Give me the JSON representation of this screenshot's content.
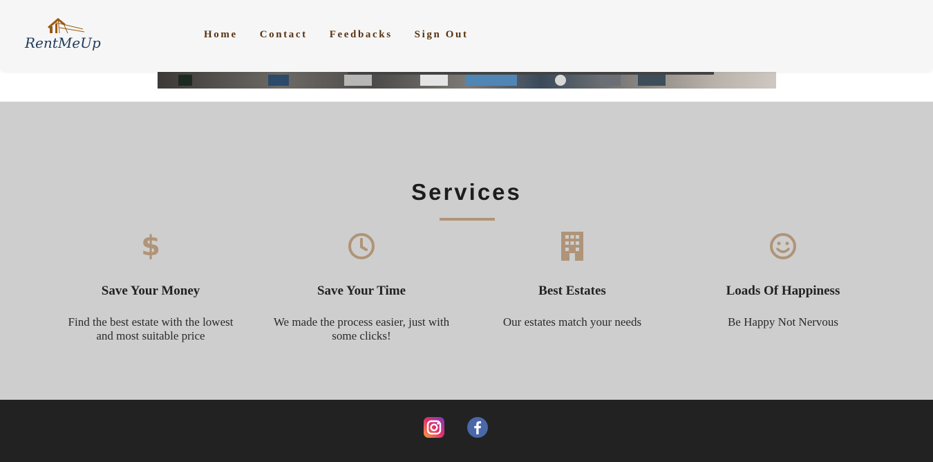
{
  "brand": {
    "logo_text": "RentMeUp"
  },
  "nav": {
    "items": [
      {
        "label": "Home"
      },
      {
        "label": "Contact"
      },
      {
        "label": "Feedbacks"
      },
      {
        "label": "Sign Out"
      }
    ]
  },
  "services": {
    "title": "Services",
    "items": [
      {
        "icon": "dollar-icon",
        "title": "Save Your Money",
        "text": "Find the best estate with the lowest and most suitable price"
      },
      {
        "icon": "clock-icon",
        "title": "Save Your Time",
        "text": "We made the process easier, just with some clicks!"
      },
      {
        "icon": "building-icon",
        "title": "Best Estates",
        "text": "Our estates match your needs"
      },
      {
        "icon": "smile-icon",
        "title": "Loads Of Happiness",
        "text": "Be Happy Not Nervous"
      }
    ]
  },
  "footer": {
    "social": [
      {
        "icon": "instagram-icon"
      },
      {
        "icon": "facebook-icon"
      }
    ]
  },
  "colors": {
    "accent": "#b09478",
    "nav_text": "#5a3210",
    "header_bg": "#f6f6f6",
    "services_bg": "#cecece",
    "footer_bg": "#222222",
    "logo_blue": "#1f3a5a",
    "logo_orange": "#9a5a12"
  }
}
